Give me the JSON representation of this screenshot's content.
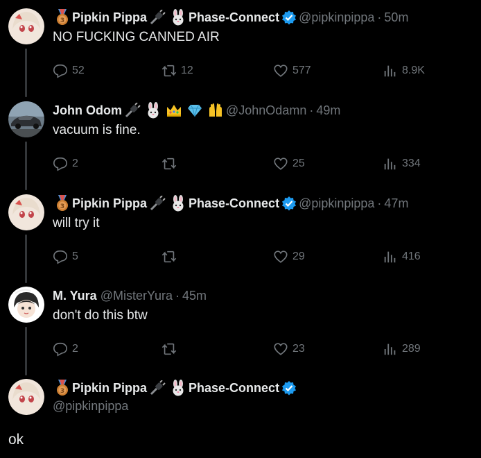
{
  "colors": {
    "background": "#000000",
    "text": "#e7e9ea",
    "muted": "#71767b",
    "verified": "#1d9bf0",
    "thread_line": "#333639"
  },
  "tweets": [
    {
      "name": "Pipkin Pippa",
      "handle": "@pipkinpippa",
      "org": "Phase-Connect",
      "time": "50m",
      "text": "NO FUCKING CANNED AIR",
      "replies": "52",
      "retweets": "12",
      "likes": "577",
      "views": "8.9K"
    },
    {
      "name": "John Odom",
      "handle": "@JohnOdamn",
      "time": "49m",
      "text": "vacuum is fine.",
      "replies": "2",
      "retweets": "",
      "likes": "25",
      "views": "334"
    },
    {
      "name": "Pipkin Pippa",
      "handle": "@pipkinpippa",
      "org": "Phase-Connect",
      "time": "47m",
      "text": "will try it",
      "replies": "5",
      "retweets": "",
      "likes": "29",
      "views": "416"
    },
    {
      "name": "M. Yura",
      "handle": "@MisterYura",
      "time": "45m",
      "text": "don't do this btw",
      "replies": "2",
      "retweets": "",
      "likes": "23",
      "views": "289"
    }
  ],
  "main_tweet": {
    "name": "Pipkin Pippa",
    "org": "Phase-Connect",
    "handle": "@pipkinpippa",
    "text": "ok"
  },
  "dot": "·"
}
